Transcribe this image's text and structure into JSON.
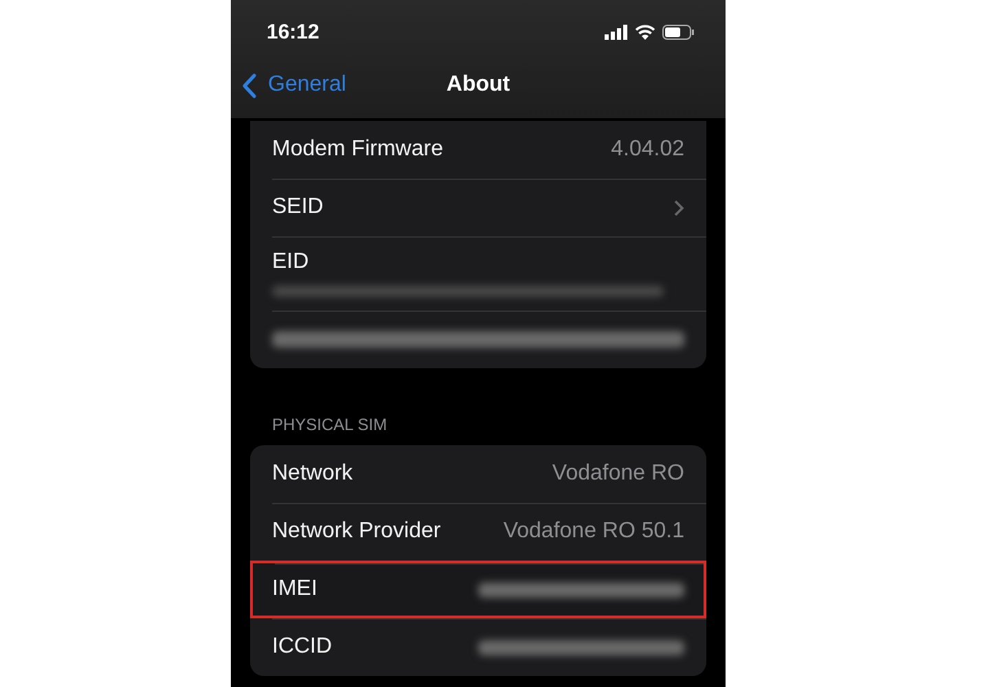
{
  "status_bar": {
    "time": "16:12"
  },
  "nav": {
    "back_label": "General",
    "title": "About"
  },
  "groups": [
    {
      "rows": [
        {
          "kind": "value",
          "label": "Modem Firmware",
          "value": "4.04.02",
          "highlighted": false
        },
        {
          "kind": "chevron",
          "label": "SEID",
          "highlighted": false
        },
        {
          "kind": "redacted-below",
          "label": "EID",
          "highlighted": false
        },
        {
          "kind": "redacted",
          "highlighted": false
        }
      ]
    },
    {
      "header": "PHYSICAL SIM",
      "rows": [
        {
          "kind": "value",
          "label": "Network",
          "value": "Vodafone RO",
          "highlighted": false
        },
        {
          "kind": "value",
          "label": "Network Provider",
          "value": "Vodafone RO 50.1",
          "highlighted": false
        },
        {
          "kind": "redacted-value",
          "label": "IMEI",
          "highlighted": true
        },
        {
          "kind": "redacted-value",
          "label": "ICCID",
          "highlighted": false
        }
      ]
    }
  ]
}
